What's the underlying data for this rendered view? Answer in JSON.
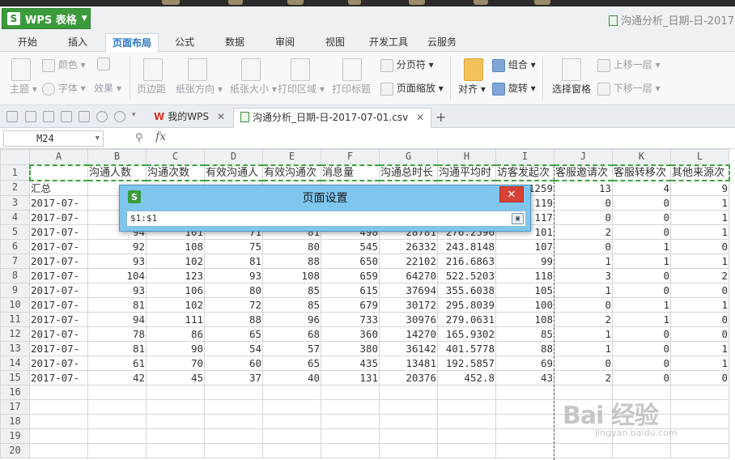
{
  "app": {
    "menu_label": "WPS 表格",
    "logo_letter": "S",
    "window_title": "沟通分析_日期-日-2017-0"
  },
  "ribbon_tabs": [
    "开始",
    "插入",
    "页面布局",
    "公式",
    "数据",
    "审阅",
    "视图",
    "开发工具",
    "云服务"
  ],
  "ribbon": {
    "color": "颜色",
    "theme": "主题",
    "font": "字体",
    "effect": "效果",
    "margins": "页边距",
    "orientation": "纸张方向",
    "size": "纸张大小",
    "print_area": "打印区域",
    "print_titles": "打印标题",
    "page_break": "分页符",
    "page_zoom": "页面缩放",
    "align": "对齐",
    "group": "组合",
    "rotate": "旋转",
    "selection_pane": "选择窗格",
    "bring_forward": "上移一层",
    "send_backward": "下移一层"
  },
  "doc_tabs": {
    "my_wps": "我的WPS",
    "file": "沟通分析_日期-日-2017-07-01.csv"
  },
  "formula_bar": {
    "cell_ref": "M24",
    "fx": "fx"
  },
  "sheet": {
    "columns": [
      "A",
      "B",
      "C",
      "D",
      "E",
      "F",
      "G",
      "H",
      "I",
      "J",
      "K",
      "L"
    ],
    "row_numbers": [
      "1",
      "2",
      "3",
      "4",
      "5",
      "6",
      "7",
      "8",
      "9",
      "10",
      "11",
      "12",
      "13",
      "14",
      "15",
      "16",
      "17",
      "18",
      "19",
      "20"
    ],
    "headers": [
      "",
      "沟通人数",
      "沟通次数",
      "有效沟通人",
      "有效沟通次",
      "消息量",
      "沟通总时长",
      "沟通平均时",
      "访客发起次",
      "客服邀请次",
      "客服转移次",
      "其他来源次"
    ],
    "rows": [
      [
        "汇总",
        "1114",
        "1265",
        "955",
        "1045",
        "7830",
        "399133",
        "3296.508",
        "1259",
        "13",
        "4",
        "9"
      ],
      [
        "2017-07-",
        "",
        "",
        "",
        "",
        "",
        "",
        "",
        "119",
        "0",
        "0",
        "1"
      ],
      [
        "2017-07-",
        "",
        "",
        "",
        "",
        "",
        "",
        "",
        "117",
        "0",
        "0",
        "1"
      ],
      [
        "2017-07-",
        "94",
        "101",
        "71",
        "81",
        "498",
        "28781",
        "276.2596",
        "101",
        "2",
        "0",
        "1"
      ],
      [
        "2017-07-",
        "92",
        "108",
        "75",
        "80",
        "545",
        "26332",
        "243.8148",
        "107",
        "0",
        "1",
        "0"
      ],
      [
        "2017-07-",
        "93",
        "102",
        "81",
        "88",
        "650",
        "22102",
        "216.6863",
        "99",
        "1",
        "1",
        "1"
      ],
      [
        "2017-07-",
        "104",
        "123",
        "93",
        "108",
        "659",
        "64270",
        "522.5203",
        "118",
        "3",
        "0",
        "2"
      ],
      [
        "2017-07-",
        "93",
        "106",
        "80",
        "85",
        "615",
        "37694",
        "355.6038",
        "105",
        "1",
        "0",
        "0"
      ],
      [
        "2017-07-",
        "81",
        "102",
        "72",
        "85",
        "679",
        "30172",
        "295.8039",
        "100",
        "0",
        "1",
        "1"
      ],
      [
        "2017-07-",
        "94",
        "111",
        "88",
        "96",
        "733",
        "30976",
        "279.0631",
        "108",
        "2",
        "1",
        "0"
      ],
      [
        "2017-07-",
        "78",
        "86",
        "65",
        "68",
        "360",
        "14270",
        "165.9302",
        "85",
        "1",
        "0",
        "0"
      ],
      [
        "2017-07-",
        "81",
        "90",
        "54",
        "57",
        "380",
        "36142",
        "401.5778",
        "88",
        "1",
        "0",
        "1"
      ],
      [
        "2017-07-",
        "61",
        "70",
        "60",
        "65",
        "435",
        "13481",
        "192.5857",
        "69",
        "0",
        "0",
        "1"
      ],
      [
        "2017-07-",
        "42",
        "45",
        "37",
        "40",
        "131",
        "20376",
        "452.8",
        "43",
        "2",
        "0",
        "0"
      ]
    ]
  },
  "dialog": {
    "title": "页面设置",
    "close": "✕",
    "logo_letter": "S",
    "input_value": "$1:$1"
  },
  "watermark": {
    "main": "Bai 经验",
    "sub": "jingyan.baidu.com"
  }
}
